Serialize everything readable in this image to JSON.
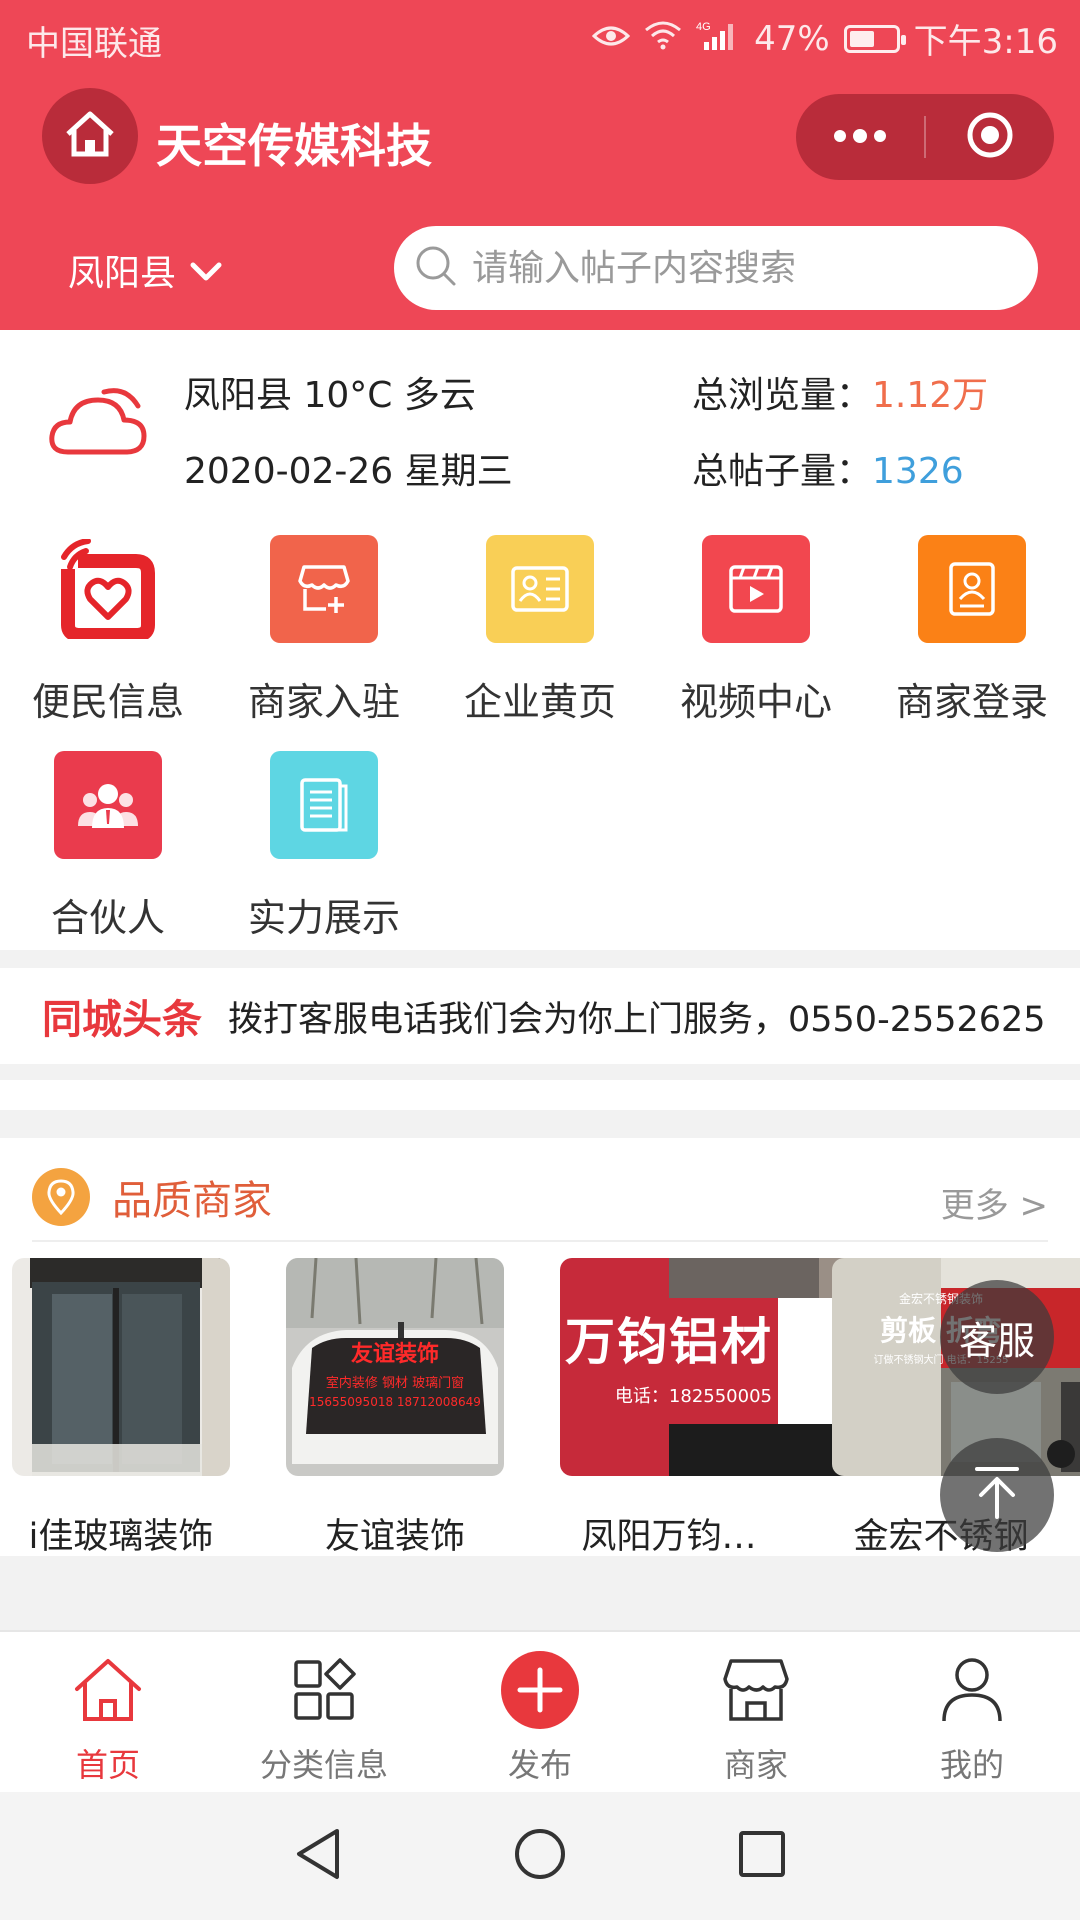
{
  "status_bar": {
    "carrier": "中国联通",
    "battery": "47%",
    "time": "下午3:16",
    "battery_level": 0.47
  },
  "header": {
    "title": "天空传媒科技",
    "region": "凤阳县",
    "search_placeholder": "请输入帖子内容搜索"
  },
  "weather": {
    "line1": "凤阳县 10°C 多云",
    "line2": "2020-02-26 星期三"
  },
  "stats": {
    "views_label": "总浏览量：",
    "views_value": "1.12万",
    "posts_label": "总帖子量：",
    "posts_value": "1326"
  },
  "grid": [
    {
      "label": "便民信息",
      "icon": "heart-phone-icon",
      "color": "#e5252a"
    },
    {
      "label": "商家入驻",
      "icon": "store-add-icon",
      "color": "#f1644b"
    },
    {
      "label": "企业黄页",
      "icon": "id-card-icon",
      "color": "#f9cf56"
    },
    {
      "label": "视频中心",
      "icon": "video-icon",
      "color": "#f2474f"
    },
    {
      "label": "商家登录",
      "icon": "badge-icon",
      "color": "#fb8116"
    },
    {
      "label": "合伙人",
      "icon": "partners-icon",
      "color": "#ea3b4d"
    },
    {
      "label": "实力展示",
      "icon": "document-icon",
      "color": "#5ed6e3"
    }
  ],
  "headline": {
    "tag": "同城头条",
    "text": "拨打客服电话我们会为你上门服务，0550-2552625"
  },
  "merchants": {
    "title": "品质商家",
    "more": "更多 >",
    "items": [
      {
        "name": "i佳玻璃装饰"
      },
      {
        "name": "友谊装饰",
        "sign_title": "友谊装饰",
        "sign_line1": "室内装修  钢材  玻璃门窗",
        "sign_line2": "15655095018  18712008649"
      },
      {
        "name": "凤阳万钧…",
        "sign_title": "万钧铝材",
        "sign_phone": "电话：182550005"
      },
      {
        "name": "金宏不锈钢",
        "sign_top": "金宏不锈钢装饰",
        "sign_title": "剪板  折弯",
        "sign_sub": "订做不锈钢大门  电话：15255"
      }
    ]
  },
  "floating": {
    "service": "客服"
  },
  "tabbar": [
    {
      "label": "首页",
      "icon": "home-icon",
      "active": true
    },
    {
      "label": "分类信息",
      "icon": "category-icon",
      "active": false
    },
    {
      "label": "发布",
      "icon": "publish-plus-icon",
      "active": false
    },
    {
      "label": "商家",
      "icon": "shop-icon",
      "active": false
    },
    {
      "label": "我的",
      "icon": "user-icon",
      "active": false
    }
  ],
  "colors": {
    "brand": "#ee4756",
    "accent_red": "#e8383d",
    "views_color": "#f06e4c",
    "posts_color": "#3f9fdc"
  }
}
